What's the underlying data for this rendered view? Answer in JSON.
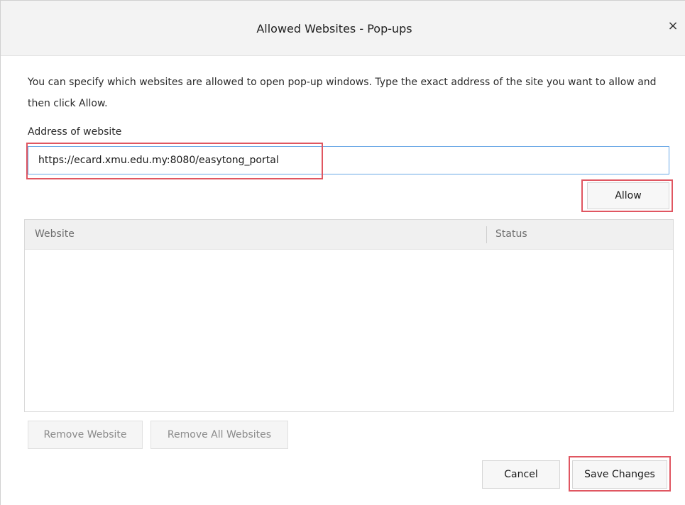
{
  "dialog": {
    "title": "Allowed Websites - Pop-ups",
    "close_glyph": "×",
    "description": "You can specify which websites are allowed to open pop-up windows. Type the exact address of the site you want to allow and then click Allow.",
    "address_label": "Address of website",
    "address_value": "https://ecard.xmu.edu.my:8080/easytong_portal",
    "allow_button": "Allow",
    "list": {
      "columns": [
        "Website",
        "Status"
      ],
      "rows": []
    },
    "remove_website_button": "Remove Website",
    "remove_all_button": "Remove All Websites",
    "cancel_button": "Cancel",
    "save_button": "Save Changes"
  },
  "colors": {
    "highlight": "#e05661",
    "input_focus_border": "#69a8e6"
  }
}
